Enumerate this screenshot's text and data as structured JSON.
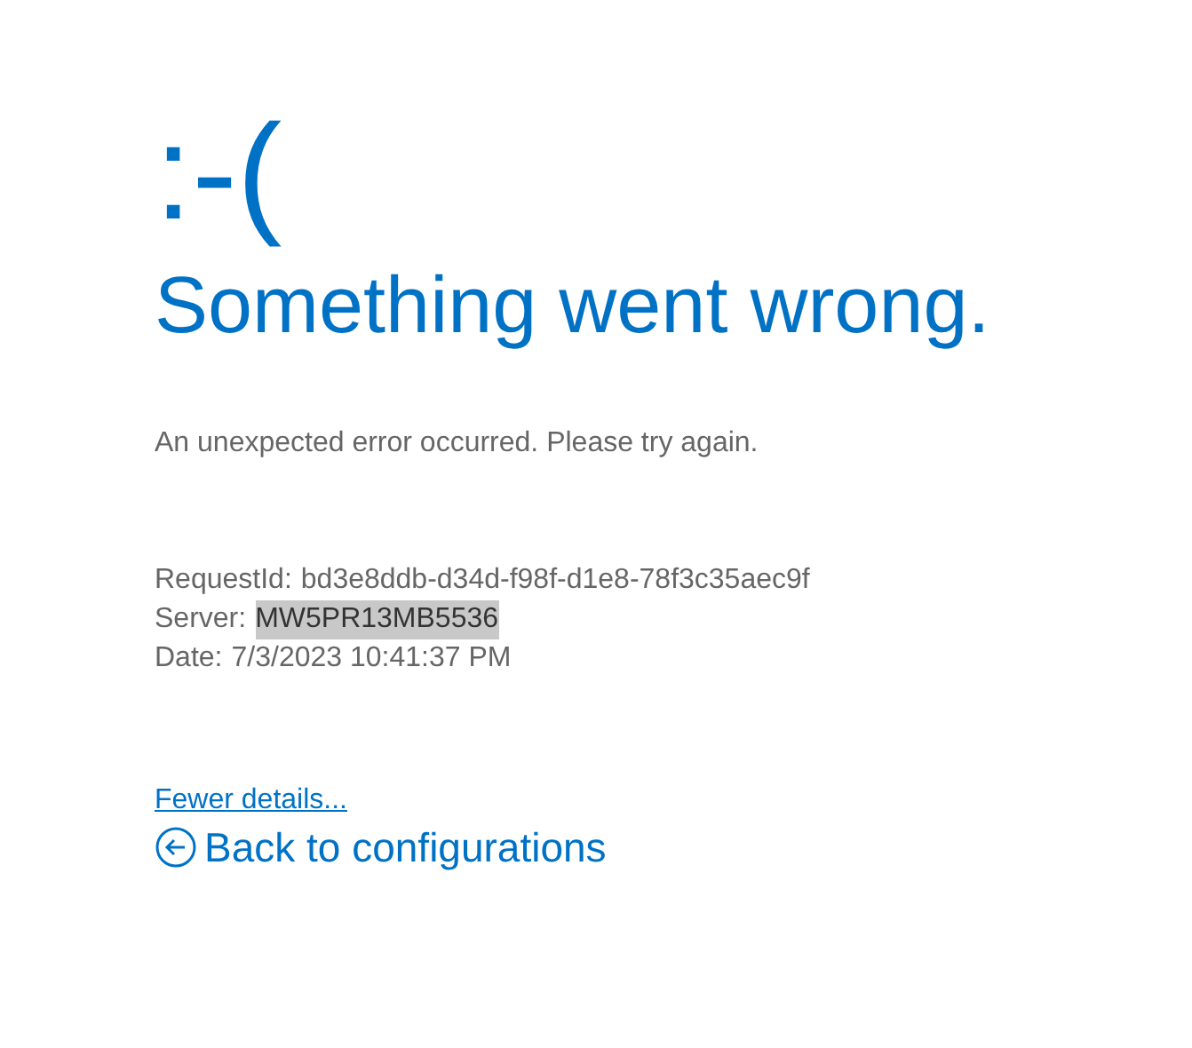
{
  "face": ":-(",
  "heading": "Something went wrong.",
  "message": "An unexpected error occurred. Please try again.",
  "details": [
    {
      "label": "RequestId:",
      "value": "bd3e8ddb-d34d-f98f-d1e8-78f3c35aec9f",
      "highlighted": false
    },
    {
      "label": "Server:",
      "value": "MW5PR13MB5536",
      "highlighted": true
    },
    {
      "label": "Date:",
      "value": "7/3/2023 10:41:37 PM",
      "highlighted": false
    }
  ],
  "details_link": "Fewer details...",
  "back_link": "Back to configurations"
}
